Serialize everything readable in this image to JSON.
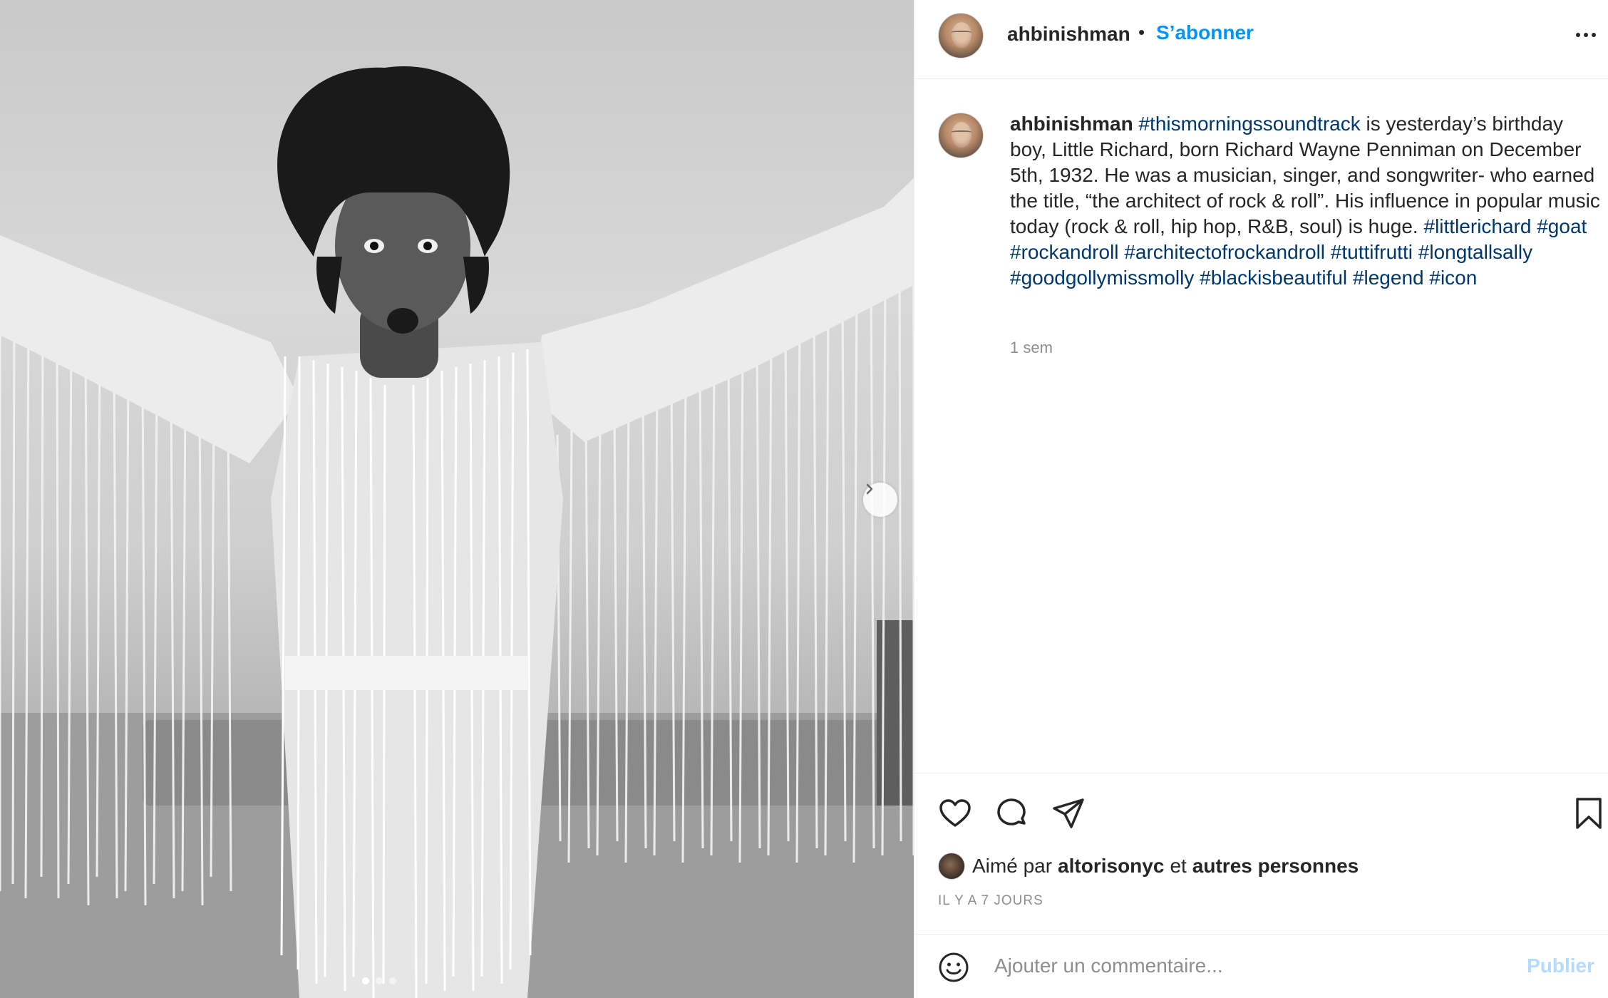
{
  "post": {
    "image_alt": "Black-and-white photo of a performer in a white fringed outfit with arms spread wide",
    "carousel_dots": 3,
    "active_dot": 0
  },
  "header": {
    "username": "ahbinishman",
    "separator": "•",
    "follow_label": "S’abonner",
    "more_icon": "more-options-icon"
  },
  "caption": {
    "username": "ahbinishman",
    "hashtag_lead": "#thismorningssoundtrack",
    "text": " is yesterday’s birthday boy, Little Richard, born Richard Wayne Penniman on December 5th, 1932. He was a musician, singer, and songwriter- who earned the title, “the architect of rock & roll”. His influence in popular music today (rock & roll, hip hop, R&B, soul) is huge. ",
    "hashtags": [
      "#littlerichard",
      "#goat",
      "#rockandroll",
      "#architectofrockandroll",
      "#tuttifrutti",
      "#longtallsally",
      "#goodgollymissmolly",
      "#blackisbeautiful",
      "#legend",
      "#icon"
    ],
    "time_ago": "1 sem"
  },
  "actions": {
    "icons": [
      "heart-icon",
      "comment-icon",
      "share-icon",
      "bookmark-icon"
    ]
  },
  "likes": {
    "prefix": "Aimé par",
    "liker": "altorisonyc",
    "conjunction": "et",
    "others": "autres personnes"
  },
  "date_label": "IL Y A 7 JOURS",
  "comment": {
    "placeholder": "Ajouter un commentaire...",
    "publish_label": "Publier",
    "emoji_icon": "emoji-icon"
  },
  "colors": {
    "link_blue": "#0095f6",
    "hashtag": "#00376b",
    "publish_disabled": "#b3dbff",
    "muted": "#8e8e8e"
  }
}
